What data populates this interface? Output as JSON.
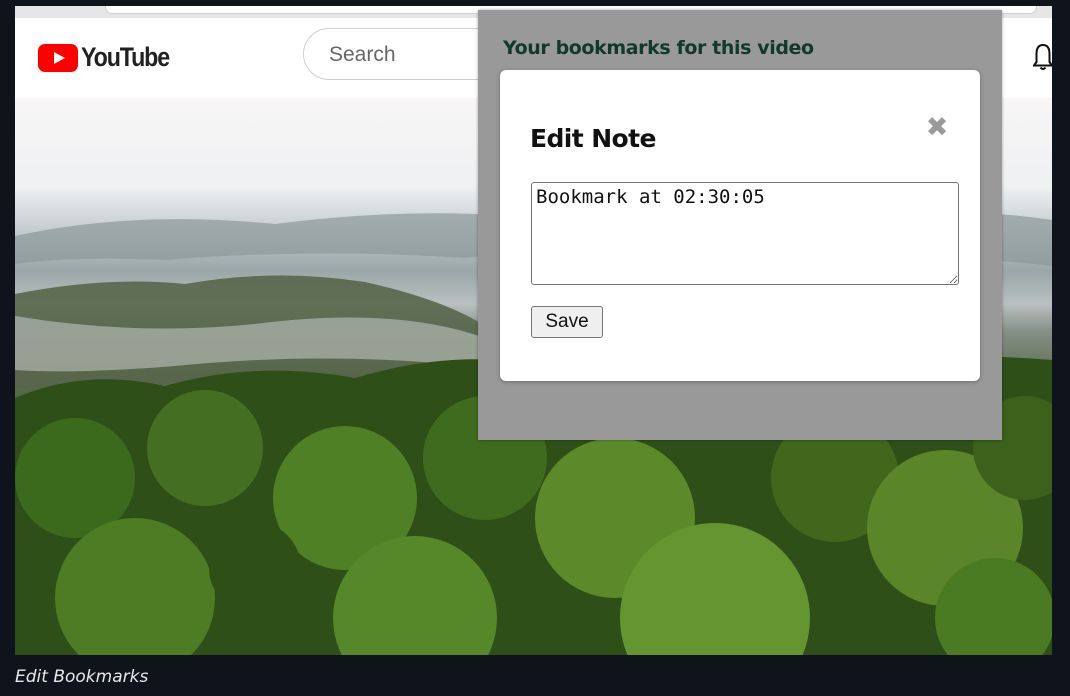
{
  "youtube": {
    "brand": "YouTube",
    "search_placeholder": "Search"
  },
  "popup": {
    "title": "Your bookmarks for this video"
  },
  "modal": {
    "title": "Edit Note",
    "close_glyph": "✖",
    "note_value": "Bookmark at 02:30:05",
    "save_label": "Save"
  },
  "caption": "Edit Bookmarks",
  "colors": {
    "brand_red": "#ff0000",
    "popup_bg": "#999999",
    "popup_title": "#12392b"
  },
  "icons": [
    "youtube-logo-icon",
    "bell-icon",
    "close-icon"
  ]
}
